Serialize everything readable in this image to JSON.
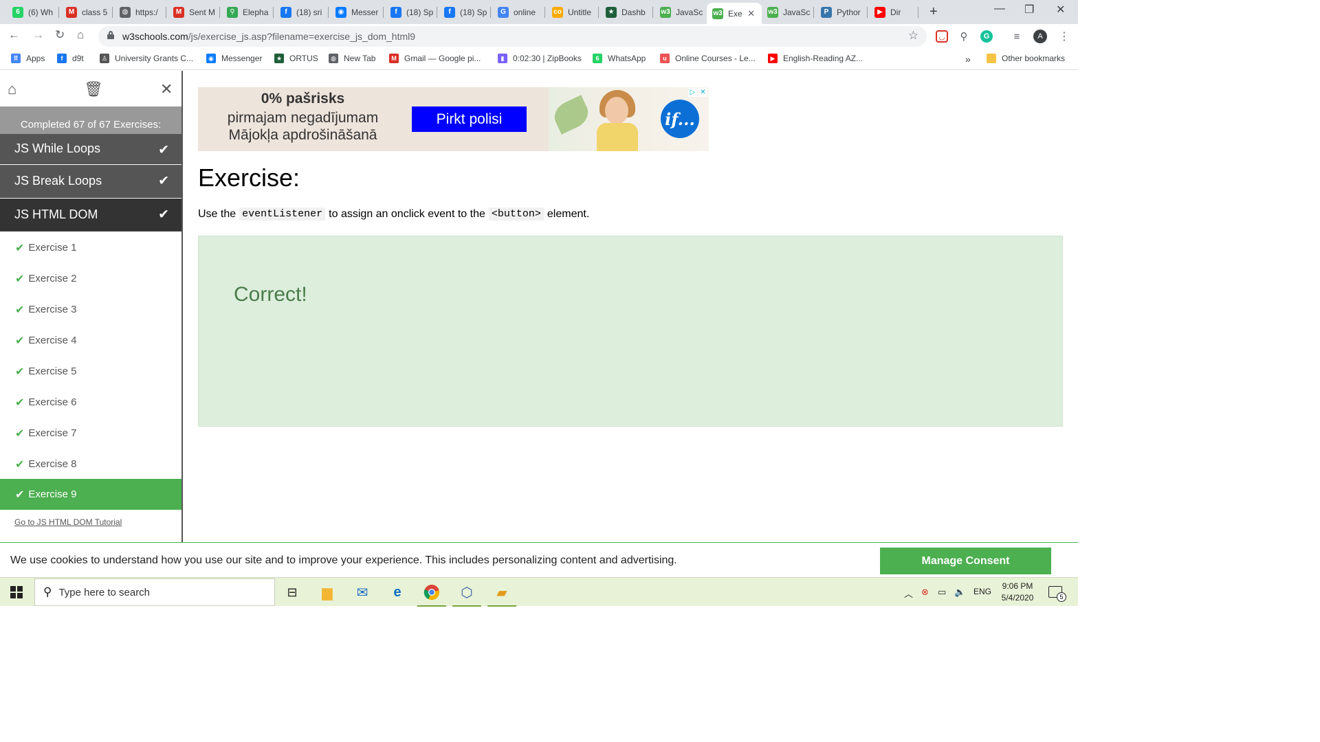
{
  "browser": {
    "tabs": [
      {
        "label": "(6) Wh",
        "icon": "whatsapp-icon",
        "color": "#25d366",
        "glyph": "6"
      },
      {
        "label": "class 5",
        "icon": "gmail-icon",
        "color": "#d93025",
        "glyph": "M"
      },
      {
        "label": "https:/",
        "icon": "globe-icon",
        "color": "#5f6368",
        "glyph": "◍"
      },
      {
        "label": "Sent M",
        "icon": "gmail-icon",
        "color": "#d93025",
        "glyph": "M"
      },
      {
        "label": "Elepha",
        "icon": "maps-icon",
        "color": "#34a853",
        "glyph": "⚲"
      },
      {
        "label": "(18) sri",
        "icon": "facebook-icon",
        "color": "#1877f2",
        "glyph": "f"
      },
      {
        "label": "Messer",
        "icon": "messenger-icon",
        "color": "#0a7cff",
        "glyph": "◉"
      },
      {
        "label": "(18) Sp",
        "icon": "facebook-icon",
        "color": "#1877f2",
        "glyph": "f"
      },
      {
        "label": "(18) Sp",
        "icon": "facebook-icon",
        "color": "#1877f2",
        "glyph": "f"
      },
      {
        "label": "online",
        "icon": "google-icon",
        "color": "#4285f4",
        "glyph": "G"
      },
      {
        "label": "Untitle",
        "icon": "colab-icon",
        "color": "#f9ab00",
        "glyph": "co"
      },
      {
        "label": "Dashb",
        "icon": "ortus-icon",
        "color": "#1e5e3a",
        "glyph": "★"
      },
      {
        "label": "JavaSc",
        "icon": "w3schools-icon",
        "color": "#4caf50",
        "glyph": "w3"
      },
      {
        "label": "Exe",
        "icon": "w3schools-icon",
        "color": "#4caf50",
        "glyph": "w3"
      },
      {
        "label": "JavaSc",
        "icon": "w3schools-icon",
        "color": "#4caf50",
        "glyph": "w3"
      },
      {
        "label": "Pythor",
        "icon": "python-icon",
        "color": "#3776ab",
        "glyph": "P"
      },
      {
        "label": "Dir",
        "icon": "youtube-icon",
        "color": "#ff0000",
        "glyph": "▶"
      }
    ],
    "url_host": "w3schools.com",
    "url_path": "/js/exercise_js.asp?filename=exercise_js_dom_html9",
    "bookmarks": [
      {
        "label": "Apps",
        "icon": "apps-grid-icon",
        "color": "#4285f4"
      },
      {
        "label": "d9t",
        "icon": "facebook-icon",
        "color": "#1877f2"
      },
      {
        "label": "University Grants C...",
        "icon": "ugc-icon",
        "color": "#555555"
      },
      {
        "label": "Messenger",
        "icon": "messenger-icon",
        "color": "#0a7cff"
      },
      {
        "label": "ORTUS",
        "icon": "ortus-icon",
        "color": "#1e5e3a"
      },
      {
        "label": "New Tab",
        "icon": "globe-icon",
        "color": "#5f6368"
      },
      {
        "label": "Gmail — Google pi...",
        "icon": "gmail-icon",
        "color": "#d93025"
      },
      {
        "label": "0:02:30 | ZipBooks",
        "icon": "zipbooks-icon",
        "color": "#7b61ff"
      },
      {
        "label": "WhatsApp",
        "icon": "whatsapp-icon",
        "color": "#25d366"
      },
      {
        "label": "Online Courses - Le...",
        "icon": "udemy-icon",
        "color": "#ec5252"
      },
      {
        "label": "English-Reading AZ...",
        "icon": "youtube-icon",
        "color": "#ff0000"
      }
    ],
    "other_bookmarks": "Other bookmarks",
    "more_bookmarks": "»",
    "avatar_letter": "A"
  },
  "sidebar": {
    "completed_text": "Completed 67 of 67 Exercises:",
    "sections": [
      {
        "label": "JS While Loops"
      },
      {
        "label": "JS Break Loops"
      },
      {
        "label": "JS HTML DOM"
      }
    ],
    "exercises": [
      {
        "label": "Exercise 1"
      },
      {
        "label": "Exercise 2"
      },
      {
        "label": "Exercise 3"
      },
      {
        "label": "Exercise 4"
      },
      {
        "label": "Exercise 5"
      },
      {
        "label": "Exercise 6"
      },
      {
        "label": "Exercise 7"
      },
      {
        "label": "Exercise 8"
      },
      {
        "label": "Exercise 9"
      }
    ],
    "tutorial_link": "Go to JS HTML DOM Tutorial"
  },
  "ad": {
    "line1": "0% pašrisks",
    "line2": "pirmajam negadījumam",
    "line3": "Mājokļa apdrošināšanā",
    "cta": "Pirkt polisi",
    "logo": "if...",
    "brand_color": "#0000ff"
  },
  "exercise": {
    "title": "Exercise:",
    "instr_pre": "Use the",
    "code1": "eventListener",
    "instr_mid": "to assign an onclick event to the",
    "code2": "<button>",
    "instr_post": "element.",
    "result": "Correct!"
  },
  "cookie": {
    "message": "We use cookies to understand how you use our site and to improve your experience. This includes personalizing content and advertising.",
    "button": "Manage Consent"
  },
  "taskbar": {
    "search_placeholder": "Type here to search",
    "language": "ENG",
    "time": "9:06 PM",
    "date": "5/4/2020",
    "notification_count": "5"
  },
  "colors": {
    "accent": "#4caf50",
    "sidebar_dark": "#555555",
    "result_bg": "#ddeedd"
  }
}
